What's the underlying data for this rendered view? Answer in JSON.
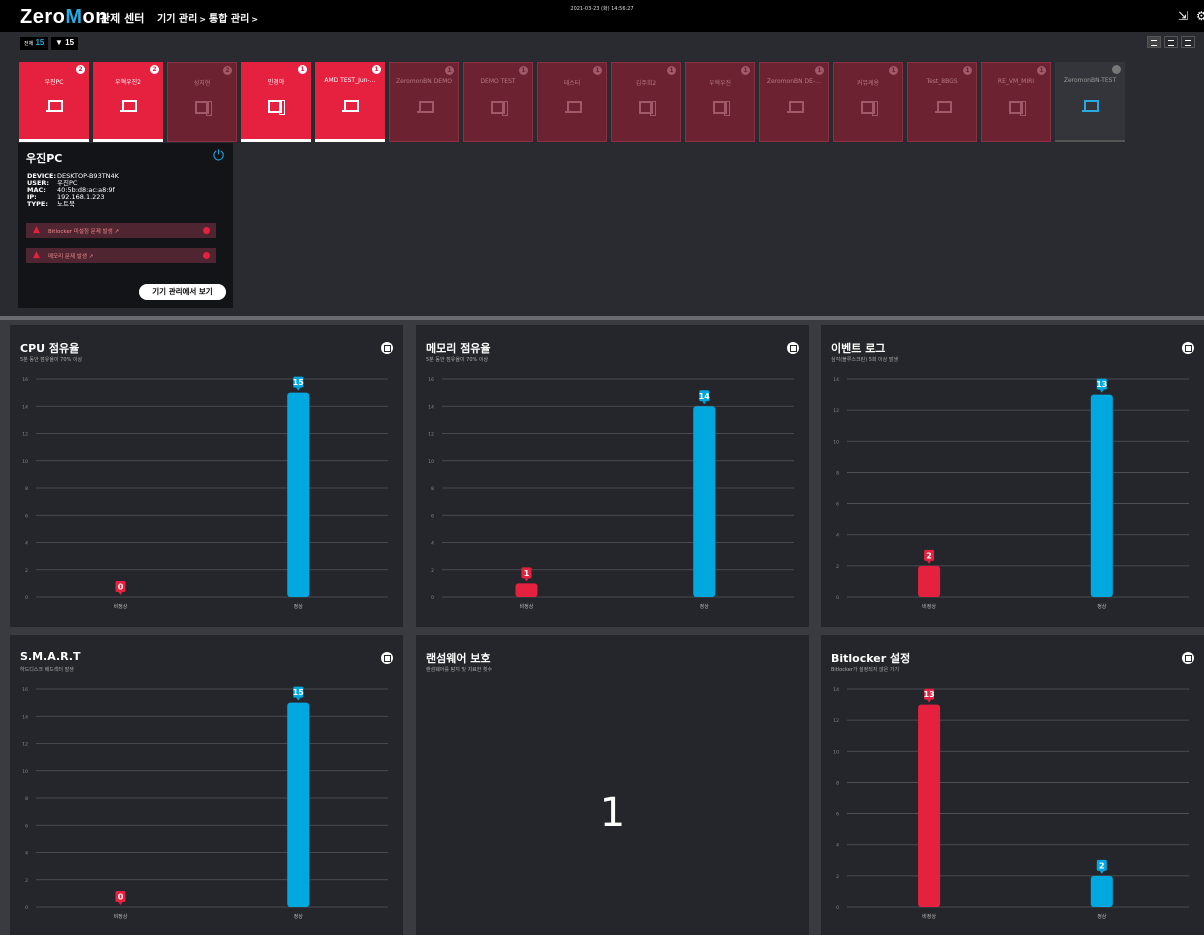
{
  "header": {
    "logo_pre": "Zero",
    "logo_m": "M",
    "logo_post": "on",
    "nav_main": "관제 센터",
    "nav_1": "기기 관리",
    "nav_2": "통합 관리",
    "datetime": "2021-03-23 (화) 14:56:27"
  },
  "filters": {
    "all_label": "전체",
    "all_count": "15",
    "filter_count": "15"
  },
  "devices": [
    {
      "name": "우진PC",
      "badge": "2",
      "type": "laptop",
      "status": "red"
    },
    {
      "name": "우혁우진2",
      "badge": "2",
      "type": "laptop",
      "status": "red"
    },
    {
      "name": "성지현",
      "badge": "2",
      "type": "desktop",
      "status": "dark"
    },
    {
      "name": "민경아",
      "badge": "1",
      "type": "desktop",
      "status": "red"
    },
    {
      "name": "AMD TEST_Jun-…",
      "badge": "1",
      "type": "laptop",
      "status": "red"
    },
    {
      "name": "ZeromonBN DEMO",
      "badge": "1",
      "type": "laptop",
      "status": "dark"
    },
    {
      "name": "DEMO TEST",
      "badge": "1",
      "type": "desktop",
      "status": "dark"
    },
    {
      "name": "테스터",
      "badge": "1",
      "type": "laptop",
      "status": "dark"
    },
    {
      "name": "김주희2",
      "badge": "1",
      "type": "desktop",
      "status": "dark"
    },
    {
      "name": "우혁우진",
      "badge": "1",
      "type": "desktop",
      "status": "dark"
    },
    {
      "name": "ZeromonBN DE-…",
      "badge": "1",
      "type": "laptop",
      "status": "dark"
    },
    {
      "name": "커뮤케용",
      "badge": "1",
      "type": "desktop",
      "status": "dark"
    },
    {
      "name": "Test_8BGS",
      "badge": "1",
      "type": "laptop",
      "status": "dark"
    },
    {
      "name": "RE_VM_MIRI",
      "badge": "1",
      "type": "desktop",
      "status": "dark"
    },
    {
      "name": "ZeromonBN-TEST",
      "badge": "",
      "type": "laptop",
      "status": "off"
    }
  ],
  "detail": {
    "title": "우진PC",
    "rows": [
      {
        "k": "DEVICE:",
        "v": "DESKTOP-B93TN4K"
      },
      {
        "k": "USER:",
        "v": "우진PC"
      },
      {
        "k": "MAC:",
        "v": "40:5b:d8:ac:a8:9f"
      },
      {
        "k": "IP:",
        "v": "192.168.1.223"
      },
      {
        "k": "TYPE:",
        "v": "노트북"
      }
    ],
    "alerts": [
      "Bitlocker 미설정 문제 발생 ↗",
      "메모리 문제 발생 ↗"
    ],
    "button": "기기 관리에서 보기"
  },
  "panels": [
    {
      "title": "CPU 점유율",
      "subtitle": "5분 동안 점유율이 70% 이상"
    },
    {
      "title": "메모리 점유율",
      "subtitle": "5분 동안 점유율이 70% 이상"
    },
    {
      "title": "이벤트 로그",
      "subtitle": "심각(블루스크린) 5회 이상 발생"
    },
    {
      "title": "S.M.A.R.T",
      "subtitle": "하드디스크 배드섹터 발생"
    },
    {
      "title": "랜섬웨어 보호",
      "subtitle": "랜섬웨어를 탐지 및 치료한 횟수",
      "value": "1"
    },
    {
      "title": "Bitlocker 설정",
      "subtitle": "Bitlocker가 설정되지 않은 기기"
    }
  ],
  "colors": {
    "abnormal": "#e6213f",
    "normal": "#00a8e0"
  },
  "chart_data": [
    {
      "type": "bar",
      "categories": [
        "비정상",
        "정상"
      ],
      "values": [
        0,
        15
      ],
      "ylim": [
        0,
        16
      ],
      "yticks": [
        0,
        2,
        4,
        6,
        8,
        10,
        12,
        14,
        16
      ]
    },
    {
      "type": "bar",
      "categories": [
        "비정상",
        "정상"
      ],
      "values": [
        1,
        14
      ],
      "ylim": [
        0,
        16
      ],
      "yticks": [
        0,
        2,
        4,
        6,
        8,
        10,
        12,
        14,
        16
      ]
    },
    {
      "type": "bar",
      "categories": [
        "비정상",
        "정상"
      ],
      "values": [
        2,
        13
      ],
      "ylim": [
        0,
        14
      ],
      "yticks": [
        0,
        2,
        4,
        6,
        8,
        10,
        12,
        14
      ]
    },
    {
      "type": "bar",
      "categories": [
        "비정상",
        "정상"
      ],
      "values": [
        0,
        15
      ],
      "ylim": [
        0,
        16
      ],
      "yticks": [
        0,
        2,
        4,
        6,
        8,
        10,
        12,
        14,
        16
      ]
    },
    {
      "type": "bar",
      "categories": [
        "비정상",
        "정상"
      ],
      "values": [
        13,
        2
      ],
      "ylim": [
        0,
        14
      ],
      "yticks": [
        0,
        2,
        4,
        6,
        8,
        10,
        12,
        14
      ]
    }
  ]
}
